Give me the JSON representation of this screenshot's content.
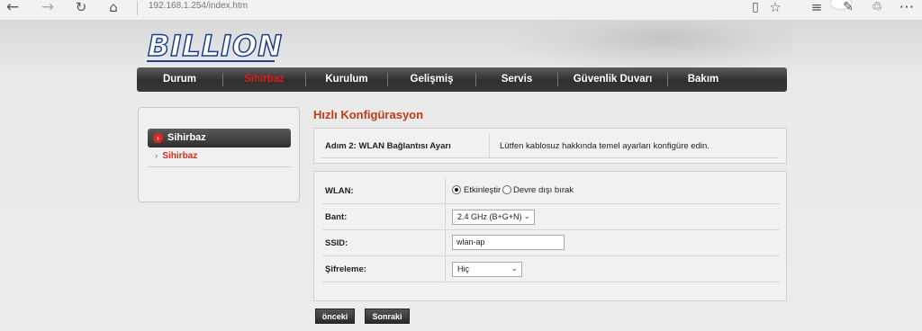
{
  "browser": {
    "url": "192.168.1.254/index.htm",
    "icons": [
      "back-icon",
      "forward-icon",
      "refresh-icon",
      "home-icon",
      "reading-view-icon",
      "favorite-star-icon",
      "hub-icon",
      "web-note-icon",
      "share-icon",
      "more-icon"
    ]
  },
  "nav": {
    "items": [
      {
        "label": "Durum",
        "active": false
      },
      {
        "label": "Sihirbaz",
        "active": true
      },
      {
        "label": "Kurulum",
        "active": false
      },
      {
        "label": "Gelişmiş",
        "active": false
      },
      {
        "label": "Servis",
        "active": false
      },
      {
        "label": "Güvenlik Duvarı",
        "active": false
      },
      {
        "label": "Bakım",
        "active": false
      }
    ]
  },
  "brand": {
    "logo_text": "BILLION",
    "color": "#1d3f8f"
  },
  "sidebar": {
    "heading": "Sihirbaz",
    "items": [
      {
        "label": "Sihirbaz",
        "active": true
      }
    ]
  },
  "main": {
    "title": "Hızlı Konfigürasyon",
    "step_label": "Adım 2: WLAN Bağlantısı Ayarı",
    "step_description": "Lütfen kablosuz hakkında temel ayarları konfigüre edin.",
    "form": {
      "wlan": {
        "label": "WLAN:",
        "option_on": "Etkinleştir",
        "option_off": "Devre dışı bırak",
        "selected": "Etkinleştir"
      },
      "band": {
        "label": "Bant:",
        "value": "2.4 GHz (B+G+N)"
      },
      "ssid": {
        "label": "SSID:",
        "value": "wlan-ap"
      },
      "encryption": {
        "label": "Şifreleme:",
        "value": "Hiç"
      }
    },
    "buttons": {
      "back": "önceki",
      "next": "Sonraki"
    }
  },
  "colors": {
    "accent_red": "#d62b1e",
    "title_orange": "#c43a12",
    "nav_dark": "#2e2e2e"
  }
}
